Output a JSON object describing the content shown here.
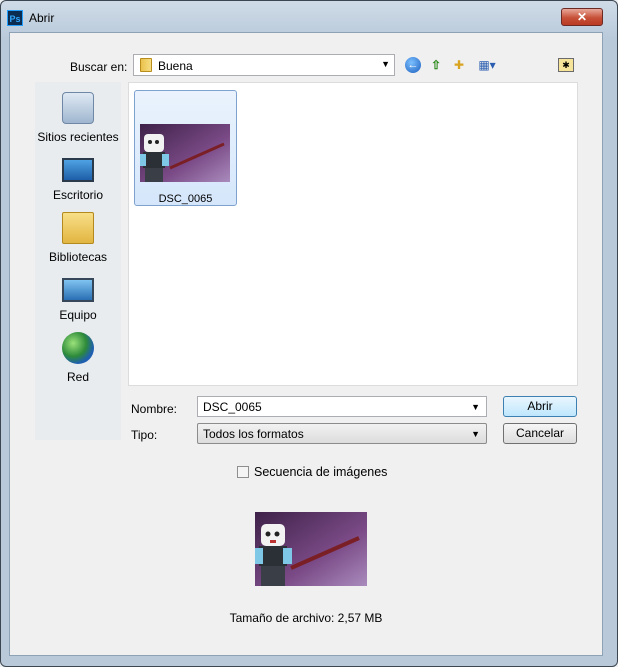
{
  "window": {
    "title": "Abrir",
    "app_icon_text": "Ps",
    "close_glyph": "✕"
  },
  "toolbar": {
    "look_in_label": "Buscar en:",
    "look_in_value": "Buena",
    "icons": [
      "back-icon",
      "up-folder-icon",
      "new-folder-icon",
      "views-menu-icon",
      "extra-folder-icon"
    ]
  },
  "places": [
    {
      "label": "Sitios recientes",
      "icon": "recent-places-icon"
    },
    {
      "label": "Escritorio",
      "icon": "desktop-icon"
    },
    {
      "label": "Bibliotecas",
      "icon": "libraries-icon"
    },
    {
      "label": "Equipo",
      "icon": "computer-icon"
    },
    {
      "label": "Red",
      "icon": "network-icon"
    }
  ],
  "files": [
    {
      "name": "DSC_0065",
      "selected": true
    }
  ],
  "form": {
    "name_label": "Nombre:",
    "name_value": "DSC_0065",
    "type_label": "Tipo:",
    "type_value": "Todos los formatos",
    "open_button": "Abrir",
    "cancel_button": "Cancelar"
  },
  "sequence": {
    "label": "Secuencia de imágenes",
    "checked": false
  },
  "preview": {
    "file_size_text": "Tamaño de archivo: 2,57 MB"
  },
  "colors": {
    "thumb_bg": "#6a3a6e",
    "accent": "#3c7fb1"
  }
}
